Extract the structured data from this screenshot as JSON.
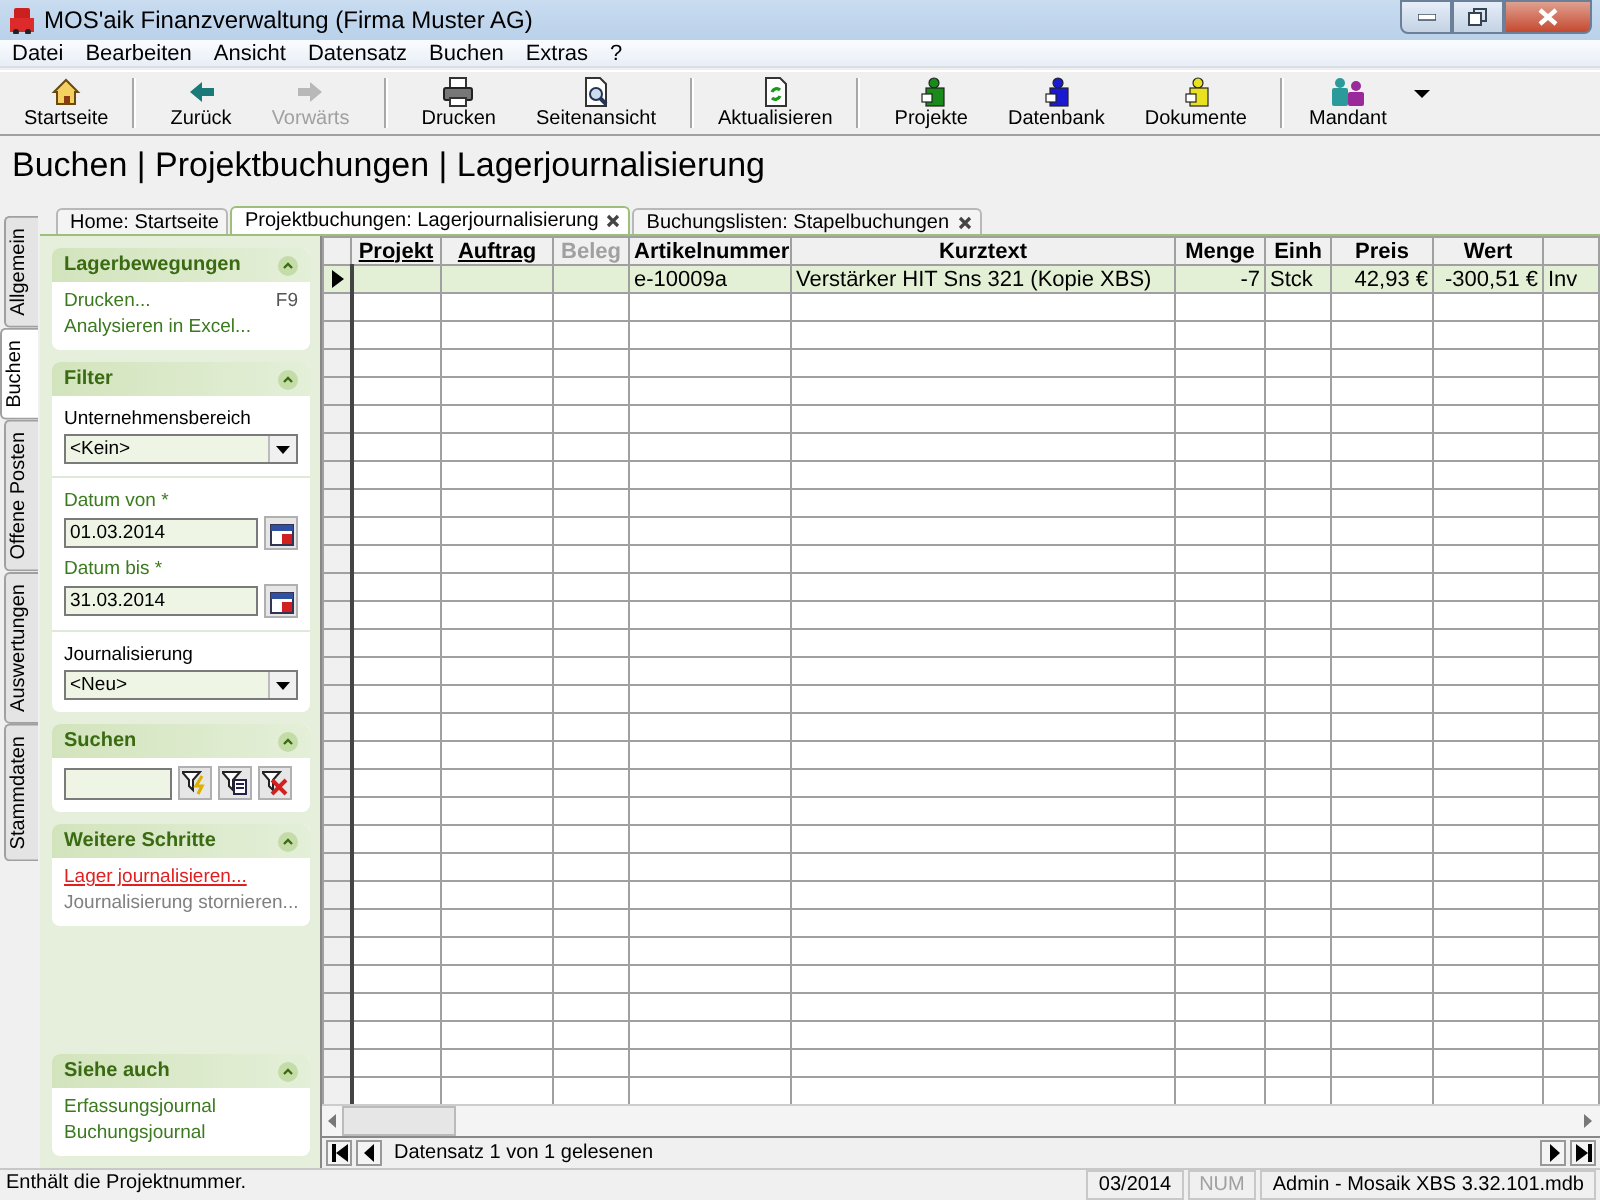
{
  "window": {
    "title": "MOS'aik Finanzverwaltung (Firma Muster AG)"
  },
  "menu": [
    {
      "label": "Datei"
    },
    {
      "label": "Bearbeiten"
    },
    {
      "label": "Ansicht"
    },
    {
      "label": "Datensatz"
    },
    {
      "label": "Buchen"
    },
    {
      "label": "Extras"
    },
    {
      "label": "?"
    }
  ],
  "toolbar": [
    [
      {
        "label": "Startseite",
        "kind": "home",
        "disabled": false,
        "menu": false
      }
    ],
    [
      {
        "label": "Zurück",
        "kind": "back",
        "disabled": false,
        "menu": false
      },
      {
        "label": "Vorwärts",
        "kind": "forward",
        "disabled": true,
        "menu": false
      }
    ],
    [
      {
        "label": "Drucken",
        "kind": "print",
        "disabled": false,
        "menu": false
      },
      {
        "label": "Seitenansicht",
        "kind": "preview",
        "disabled": false,
        "menu": false
      }
    ],
    [
      {
        "label": "Aktualisieren",
        "kind": "refresh",
        "disabled": false,
        "menu": false
      }
    ],
    [
      {
        "label": "Projekte",
        "kind": "figure",
        "color": "#1a8a1a",
        "disabled": false,
        "menu": false
      },
      {
        "label": "Datenbank",
        "kind": "figure",
        "color": "#1a1ad0",
        "disabled": false,
        "menu": false
      },
      {
        "label": "Dokumente",
        "kind": "figure",
        "color": "#e8e020",
        "disabled": false,
        "menu": false
      }
    ],
    [
      {
        "label": "Mandant",
        "kind": "people",
        "disabled": false,
        "menu": true
      }
    ]
  ],
  "heading": "Buchen | Projektbuchungen | Lagerjournalisierung",
  "side_tabs": [
    {
      "label": "Allgemein",
      "selected": false
    },
    {
      "label": "Buchen",
      "selected": true
    },
    {
      "label": "Offene Posten",
      "selected": false
    },
    {
      "label": "Auswertungen",
      "selected": false
    },
    {
      "label": "Stammdaten",
      "selected": false
    }
  ],
  "doc_tabs": [
    {
      "label": "Home: Startseite",
      "selected": false,
      "closable": false
    },
    {
      "label": "Projektbuchungen: Lagerjournalisierung",
      "selected": true,
      "closable": true
    },
    {
      "label": "Buchungslisten: Stapelbuchungen",
      "selected": false,
      "closable": true
    }
  ],
  "side_panel": {
    "sections": [
      {
        "title": "Lagerbewegungen",
        "expanded": true,
        "groups": [
          [
            {
              "kind": "link",
              "label": "Drucken...",
              "shortcut": "F9",
              "highlighted": false,
              "disabled": false
            },
            {
              "kind": "link",
              "label": "Analysieren in Excel...",
              "highlighted": false,
              "disabled": false
            }
          ]
        ]
      },
      {
        "title": "Filter",
        "expanded": true,
        "groups": [
          [
            {
              "kind": "select",
              "label": "Unternehmensbereich",
              "required": false,
              "value": "<Kein>"
            }
          ],
          [
            {
              "kind": "date",
              "label": "Datum von *",
              "required": true,
              "value": "01.03.2014"
            },
            {
              "kind": "date",
              "label": "Datum bis *",
              "required": true,
              "value": "31.03.2014"
            }
          ],
          [
            {
              "kind": "select",
              "label": "Journalisierung",
              "required": false,
              "value": "<Neu>"
            }
          ]
        ]
      },
      {
        "title": "Suchen",
        "expanded": true,
        "groups": [
          [
            {
              "kind": "search"
            }
          ]
        ]
      },
      {
        "title": "Weitere Schritte",
        "expanded": true,
        "groups": [
          [
            {
              "kind": "link",
              "label": "Lager journalisieren...",
              "highlighted": true,
              "disabled": false
            },
            {
              "kind": "link",
              "label": "Journalisierung stornieren...",
              "highlighted": false,
              "disabled": true
            }
          ]
        ]
      }
    ],
    "footer_section": {
      "title": "Siehe auch",
      "expanded": true,
      "groups": [
        [
          {
            "kind": "link",
            "label": "Erfassungsjournal",
            "highlighted": false,
            "disabled": false
          },
          {
            "kind": "link",
            "label": "Buchungsjournal",
            "highlighted": false,
            "disabled": false
          }
        ]
      ]
    }
  },
  "table": {
    "columns": [
      {
        "label": "Projekt",
        "kind": "sortable"
      },
      {
        "label": "Auftrag",
        "kind": "sortable"
      },
      {
        "label": "Beleg",
        "kind": "disabled"
      },
      {
        "label": "Artikelnummer",
        "kind": "plain"
      },
      {
        "label": "Kurztext",
        "kind": "plain"
      },
      {
        "label": "Menge",
        "kind": "number"
      },
      {
        "label": "Einh",
        "kind": "plain"
      },
      {
        "label": "Preis",
        "kind": "number"
      },
      {
        "label": "Wert",
        "kind": "number"
      },
      {
        "kind": "plain"
      }
    ],
    "rows": [
      {
        "selected": true,
        "cells": [
          null,
          null,
          null,
          "e-10009a",
          "Verstärker HIT Sns 321 (Kopie XBS)",
          "-7",
          "Stck",
          "42,93 €",
          "-300,51 €",
          "Inv"
        ]
      }
    ],
    "navigator": "Datensatz 1 von 1 gelesenen"
  },
  "status_bar": {
    "message": "Enthält die Projektnummer.",
    "period": "03/2014",
    "num_lock": {
      "label": "NUM",
      "on": false
    },
    "database": "Admin - Mosaik XBS 3.32.101.mdb"
  }
}
